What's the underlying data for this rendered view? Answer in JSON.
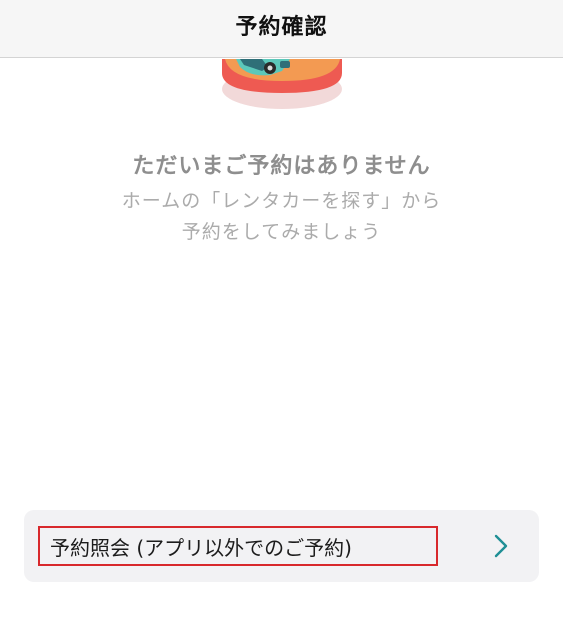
{
  "header": {
    "title": "予約確認"
  },
  "empty_state": {
    "title": "ただいまご予約はありません",
    "description_line1": "ホームの「レンタカーを探す」から",
    "description_line2": "予約をしてみましょう",
    "illustration_icon": "car-illustration-icon"
  },
  "inquiry": {
    "label": "予約照会 (アプリ以外でのご予約)",
    "chevron_icon": "chevron-right-icon"
  },
  "colors": {
    "header_bg": "#f6f6f6",
    "empty_title": "#8e8e8e",
    "empty_desc": "#ababab",
    "row_bg": "#f2f2f4",
    "chevron": "#1f8f95",
    "highlight_border": "#d8282c"
  }
}
